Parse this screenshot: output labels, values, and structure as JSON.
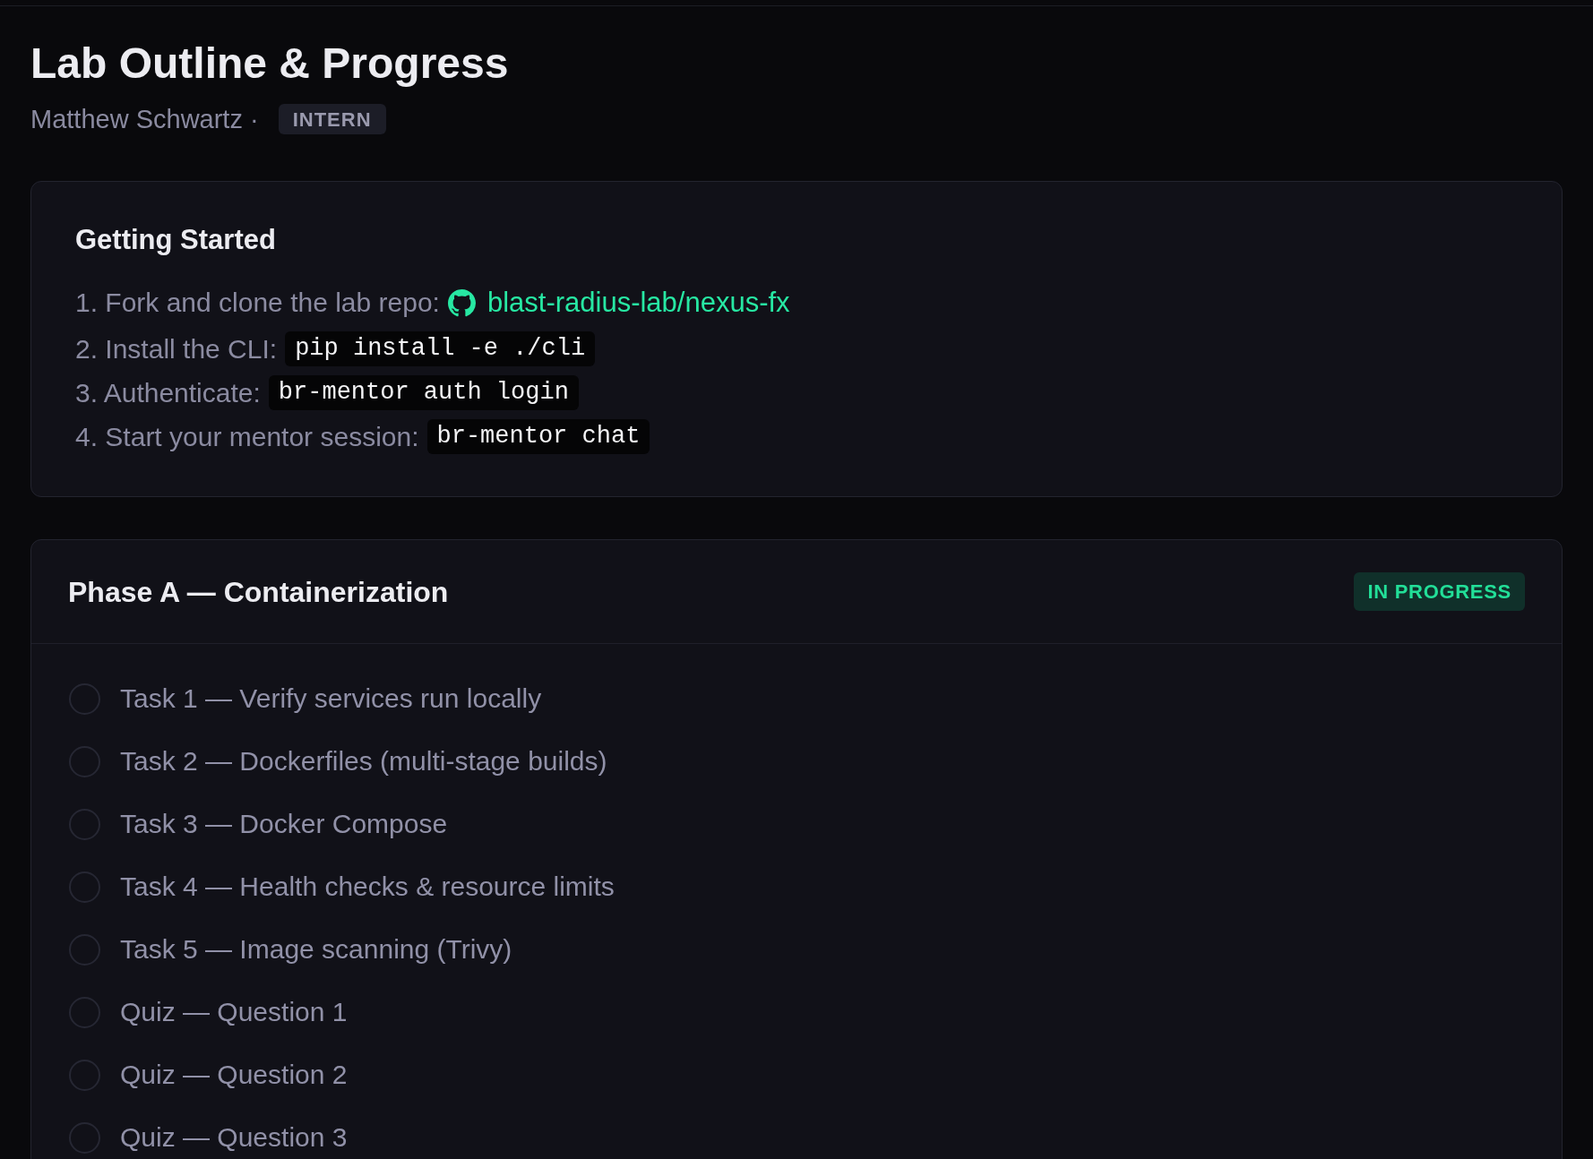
{
  "header": {
    "title": "Lab Outline & Progress",
    "author": "Matthew Schwartz ·",
    "role_badge": "INTERN"
  },
  "getting_started": {
    "title": "Getting Started",
    "steps": [
      {
        "kind": "link",
        "label": "1. Fork and clone the lab repo:",
        "link": "blast-radius-lab/nexus-fx"
      },
      {
        "kind": "code",
        "label": "2. Install the CLI:",
        "code": "pip install -e ./cli"
      },
      {
        "kind": "code",
        "label": "3. Authenticate:",
        "code": "br-mentor auth login"
      },
      {
        "kind": "code",
        "label": "4. Start your mentor session:",
        "code": "br-mentor chat"
      }
    ]
  },
  "phases": [
    {
      "title": "Phase A — Containerization",
      "status": "IN PROGRESS",
      "tasks": [
        {
          "label": "Task 1 — Verify services run locally",
          "checked": false
        },
        {
          "label": "Task 2 — Dockerfiles (multi-stage builds)",
          "checked": false
        },
        {
          "label": "Task 3 — Docker Compose",
          "checked": false
        },
        {
          "label": "Task 4 — Health checks & resource limits",
          "checked": false
        },
        {
          "label": "Task 5 — Image scanning (Trivy)",
          "checked": false
        },
        {
          "label": "Quiz — Question 1",
          "checked": false
        },
        {
          "label": "Quiz — Question 2",
          "checked": false
        },
        {
          "label": "Quiz — Question 3",
          "checked": false
        }
      ]
    }
  ]
}
